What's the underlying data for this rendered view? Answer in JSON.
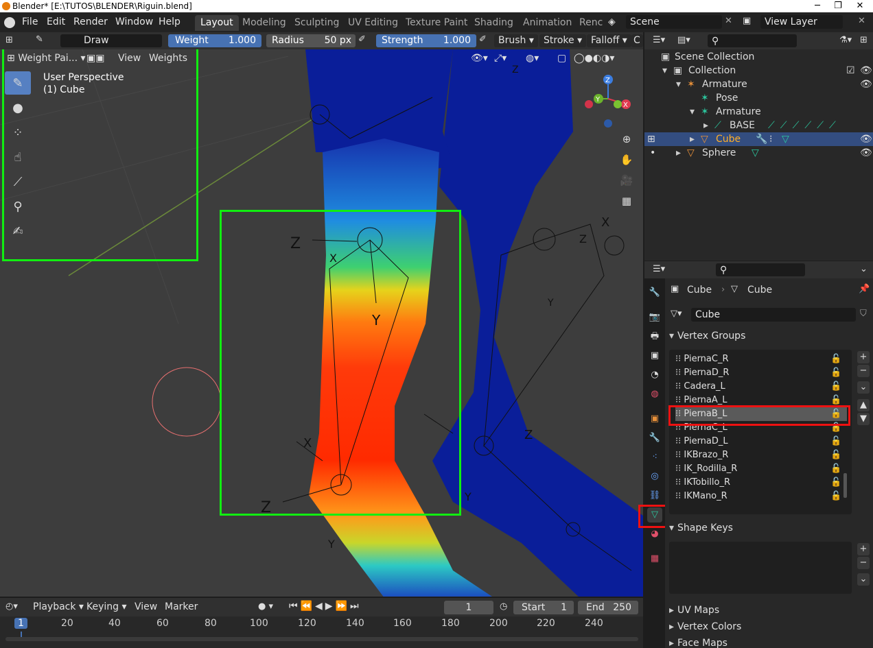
{
  "window": {
    "title": "Blender* [E:\\TUTOS\\BLENDER\\Riguin.blend]"
  },
  "menu": [
    "File",
    "Edit",
    "Render",
    "Window",
    "Help"
  ],
  "workspaces": [
    "Layout",
    "Modeling",
    "Sculpting",
    "UV Editing",
    "Texture Paint",
    "Shading",
    "Animation",
    "Renc"
  ],
  "scene": "Scene",
  "view_layer": "View Layer",
  "tool_header": {
    "brush_name": "Draw",
    "weight_label": "Weight",
    "weight_value": "1.000",
    "radius_label": "Radius",
    "radius_value": "50 px",
    "strength_label": "Strength",
    "strength_value": "1.000",
    "brush_menu": "Brush",
    "stroke_menu": "Stroke",
    "falloff_menu": "Falloff"
  },
  "viewport": {
    "mode": "Weight Pai...",
    "view_menu": "View",
    "weights_menu": "Weights",
    "perspective": "User Perspective",
    "object": "(1) Cube"
  },
  "outliner": {
    "rows": [
      {
        "label": "Scene Collection"
      },
      {
        "label": "Collection"
      },
      {
        "label": "Armature"
      },
      {
        "label": "Pose"
      },
      {
        "label": "Armature"
      },
      {
        "label": "BASE"
      },
      {
        "label": "Cube"
      },
      {
        "label": "Sphere"
      }
    ]
  },
  "properties": {
    "breadcrumb_object": "Cube",
    "breadcrumb_mesh": "Cube",
    "mesh_name": "Cube",
    "vertex_groups_title": "Vertex Groups",
    "vertex_groups": [
      "PiernaC_R",
      "PiernaD_R",
      "Cadera_L",
      "PiernaA_L",
      "PiernaB_L",
      "PiernaC_L",
      "PiernaD_L",
      "IKBrazo_R",
      "IK_Rodilla_R",
      "IKTobillo_R",
      "IKMano_R"
    ],
    "selected_group": "PiernaB_L",
    "shape_keys_title": "Shape Keys",
    "uv_maps_title": "UV Maps",
    "vertex_colors_title": "Vertex Colors",
    "face_maps_title": "Face Maps"
  },
  "timeline": {
    "playback": "Playback",
    "keying": "Keying",
    "view": "View",
    "marker": "Marker",
    "current_frame": "1",
    "start_label": "Start",
    "start_value": "1",
    "end_label": "End",
    "end_value": "250",
    "ticks": [
      "1",
      "20",
      "40",
      "60",
      "80",
      "100",
      "120",
      "140",
      "160",
      "180",
      "200",
      "220",
      "240"
    ]
  },
  "colors": {
    "accent": "#5680c2",
    "highlight_green": "#11ee11",
    "highlight_red": "#ee1111"
  }
}
